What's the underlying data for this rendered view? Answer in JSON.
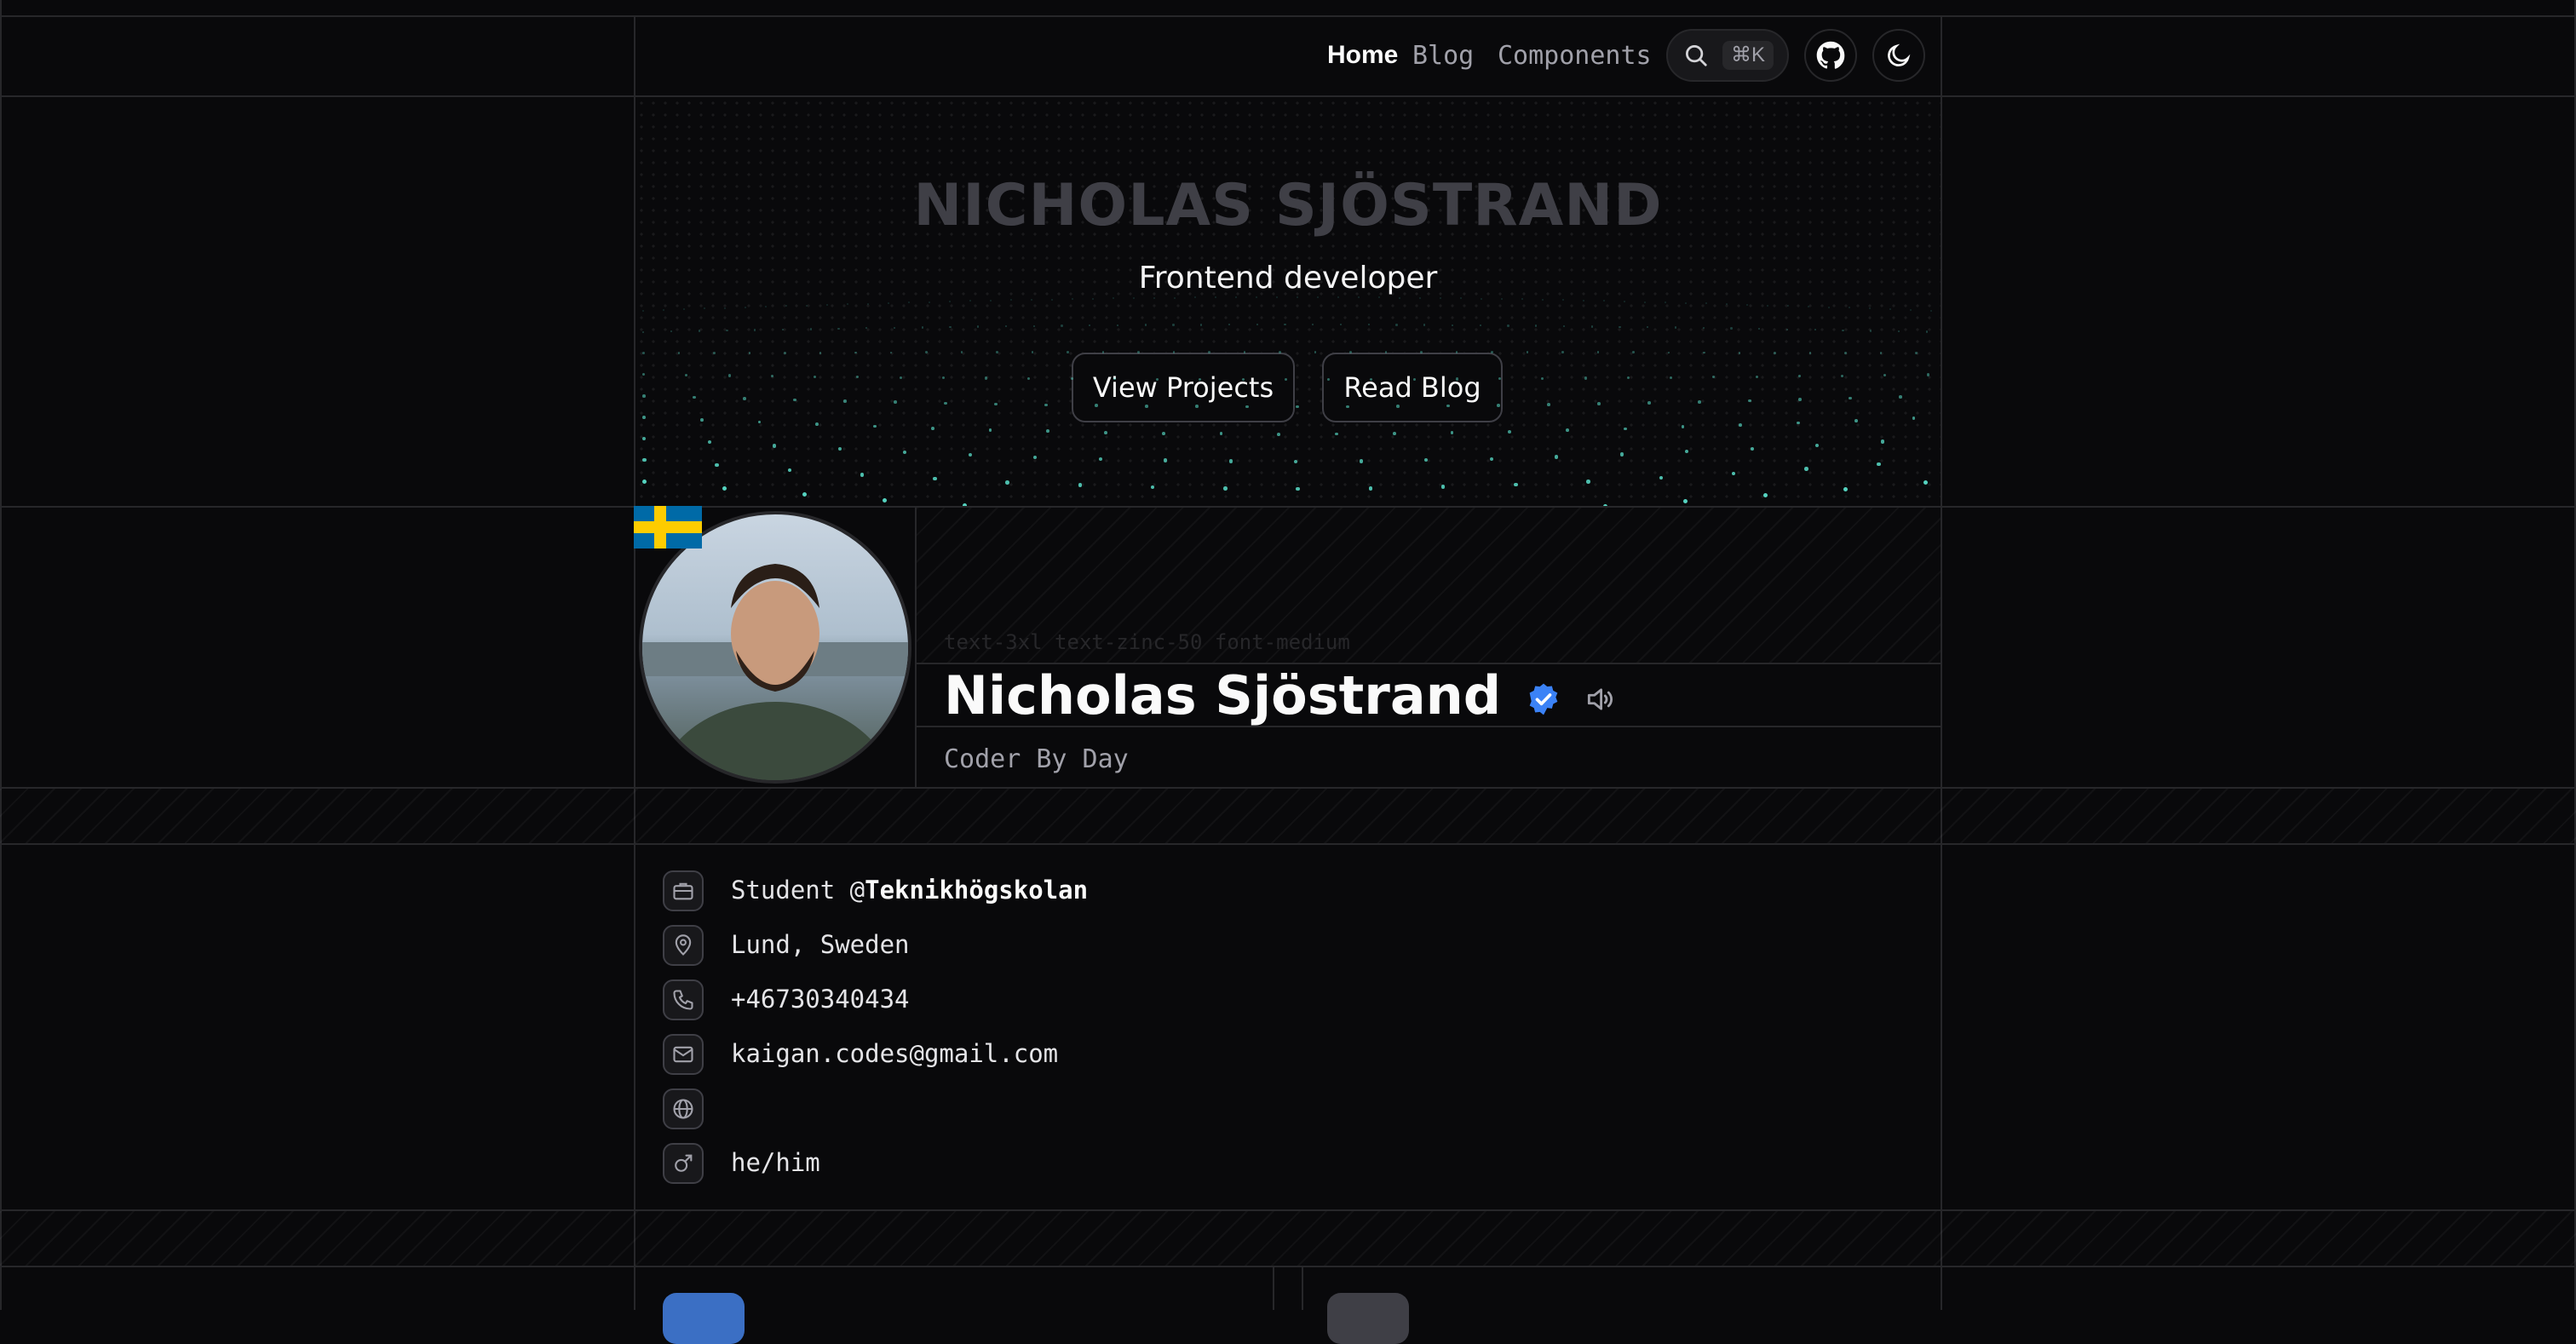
{
  "nav": {
    "links": [
      "Home",
      "Blog",
      "Components"
    ],
    "active": "Home",
    "search_shortcut": "⌘K",
    "github_icon": "github-icon",
    "theme_icon": "moon-icon"
  },
  "hero": {
    "title": "NICHOLAS SJÖSTRAND",
    "subtitle": "Frontend developer",
    "buttons": [
      "View Projects",
      "Read Blog"
    ]
  },
  "profile": {
    "flag": "Sweden",
    "class_hint": "text-3xl text-zinc-50 font-medium",
    "name": "Nicholas Sjöstrand",
    "verified_icon": "verified-badge-icon",
    "pronounce_icon": "speaker-icon",
    "tagline": "Coder By Day"
  },
  "info": {
    "job_prefix": "Student @",
    "job_org": "Teknikhögskolan",
    "location": "Lund, Sweden",
    "phone": "+46730340434",
    "email": "kaigan.codes@gmail.com",
    "website": "",
    "pronouns": "he/him"
  },
  "colors": {
    "background": "#09090b",
    "border": "#27272a",
    "accent_dots": "#5eead4",
    "verified_blue": "#3b82f6",
    "flag_blue": "#006aa7",
    "flag_yellow": "#fecc00"
  }
}
